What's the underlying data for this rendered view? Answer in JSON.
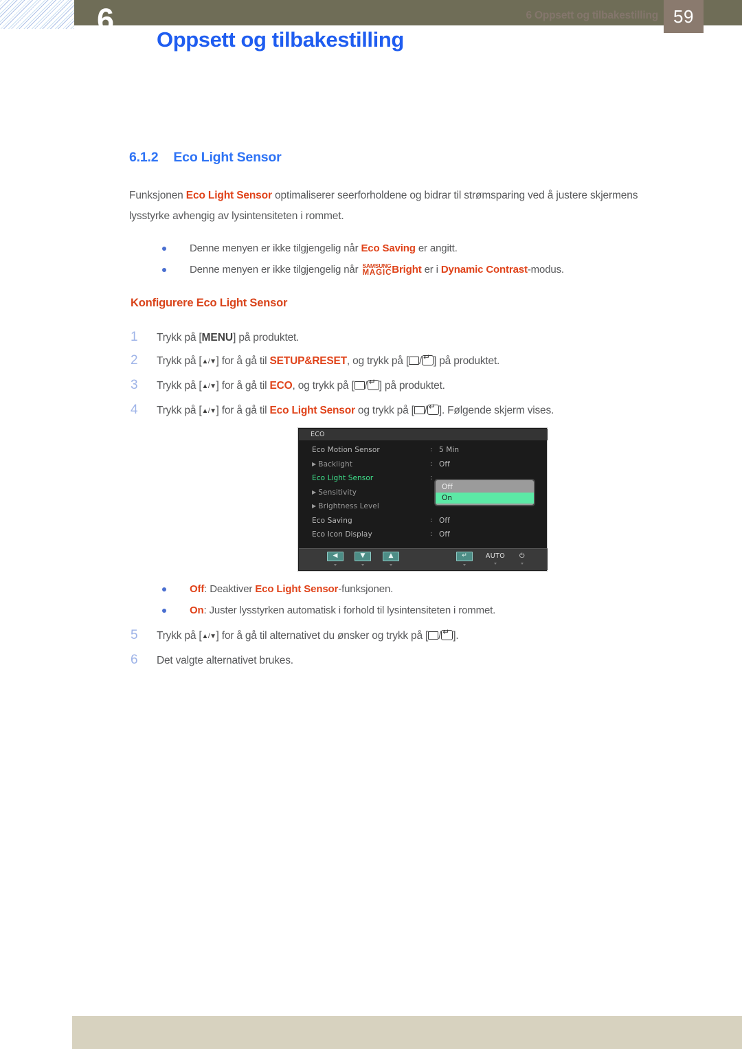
{
  "header": {
    "chapter_number": "6",
    "chapter_title": "Oppsett og tilbakestilling"
  },
  "section": {
    "number": "6.1.2",
    "title": "Eco Light Sensor",
    "intro_parts": {
      "p1": "Funksjonen ",
      "term1": "Eco Light Sensor",
      "p2": " optimaliserer seerforholdene og bidrar til strømsparing ved å justere skjermens lysstyrke avhengig av lysintensiteten i rommet."
    }
  },
  "notes": [
    {
      "pre": "Denne menyen er ikke tilgjengelig når ",
      "term": "Eco Saving",
      "post": " er angitt."
    },
    {
      "pre": "Denne menyen er ikke tilgjengelig når ",
      "logo_top": "SAMSUNG",
      "logo_bottom": "MAGIC",
      "term": "Bright",
      "mid": " er i ",
      "term2": "Dynamic Contrast",
      "post": "-modus."
    }
  ],
  "procedure": {
    "heading": "Konfigurere Eco Light Sensor",
    "steps_before": [
      {
        "num": "1",
        "pre": "Trykk på [",
        "key": "MENU",
        "post": "] på produktet."
      },
      {
        "num": "2",
        "pre": "Trykk på [",
        "arrows": "▲/▼",
        "mid": "] for å gå til ",
        "term": "SETUP&RESET",
        "mid2": ", og trykk på [",
        "mid3": "/",
        "post": "] på produktet."
      },
      {
        "num": "3",
        "pre": "Trykk på [",
        "arrows": "▲/▼",
        "mid": "] for å gå til ",
        "term": "ECO",
        "mid2": ", og trykk på [",
        "mid3": "/",
        "post": "] på produktet."
      },
      {
        "num": "4",
        "pre": "Trykk på [",
        "arrows": "▲/▼",
        "mid": "] for å gå til ",
        "term": "Eco Light Sensor",
        "mid2": " og trykk på [",
        "mid3": "/",
        "post": "]. Følgende skjerm vises."
      }
    ],
    "options": [
      {
        "term": "Off",
        "mid": ": Deaktiver ",
        "term2": "Eco Light Sensor",
        "post": "-funksjonen."
      },
      {
        "term": "On",
        "mid": ": Juster lysstyrken automatisk i forhold til lysintensiteten i rommet.",
        "term2": "",
        "post": ""
      }
    ],
    "steps_after": [
      {
        "num": "5",
        "pre": "Trykk på [",
        "arrows": "▲/▼",
        "mid": "] for å gå til alternativet du ønsker og trykk på [",
        "mid3": "/",
        "post": "]."
      },
      {
        "num": "6",
        "pre": "Det valgte alternativet brukes.",
        "arrows": "",
        "mid": "",
        "mid3": "",
        "post": ""
      }
    ]
  },
  "osd": {
    "title": "ECO",
    "rows": [
      {
        "label": "Eco Motion Sensor",
        "value": "5 Min",
        "sub": false,
        "active": false,
        "has_value": true
      },
      {
        "label": "Backlight",
        "value": "Off",
        "sub": true,
        "active": false,
        "has_value": true
      },
      {
        "label": "Eco Light Sensor",
        "value": "",
        "sub": false,
        "active": true,
        "has_value": true
      },
      {
        "label": "Sensitivity",
        "value": "",
        "sub": true,
        "active": false,
        "has_value": false
      },
      {
        "label": "Brightness Level",
        "value": "",
        "sub": true,
        "active": false,
        "has_value": false
      },
      {
        "label": "Eco Saving",
        "value": "Off",
        "sub": false,
        "active": false,
        "has_value": true
      },
      {
        "label": "Eco Icon Display",
        "value": "Off",
        "sub": false,
        "active": false,
        "has_value": true
      }
    ],
    "dropdown": {
      "options": [
        {
          "label": "Off",
          "selected": false
        },
        {
          "label": "On",
          "selected": true
        }
      ]
    },
    "toolbar": [
      {
        "icon": "left-arrow-icon",
        "label": "◀",
        "plain": false
      },
      {
        "icon": "down-arrow-icon",
        "label": "▼",
        "plain": false
      },
      {
        "icon": "up-arrow-icon",
        "label": "▲",
        "plain": false
      },
      {
        "icon": "enter-icon",
        "label": "↵",
        "plain": false
      },
      {
        "icon": "auto-button",
        "label": "AUTO",
        "plain": true
      },
      {
        "icon": "power-icon",
        "label": "⏻",
        "plain": true
      }
    ]
  },
  "footer": {
    "text": "6 Oppsett og tilbakestilling",
    "page": "59"
  },
  "colors": {
    "accent_blue": "#2e73f5",
    "accent_orange": "#d9441b",
    "olive": "#6f6d57",
    "footer_beige": "#d7d2bf",
    "footer_brown": "#8a7a6e",
    "osd_green": "#5ce9a6"
  }
}
